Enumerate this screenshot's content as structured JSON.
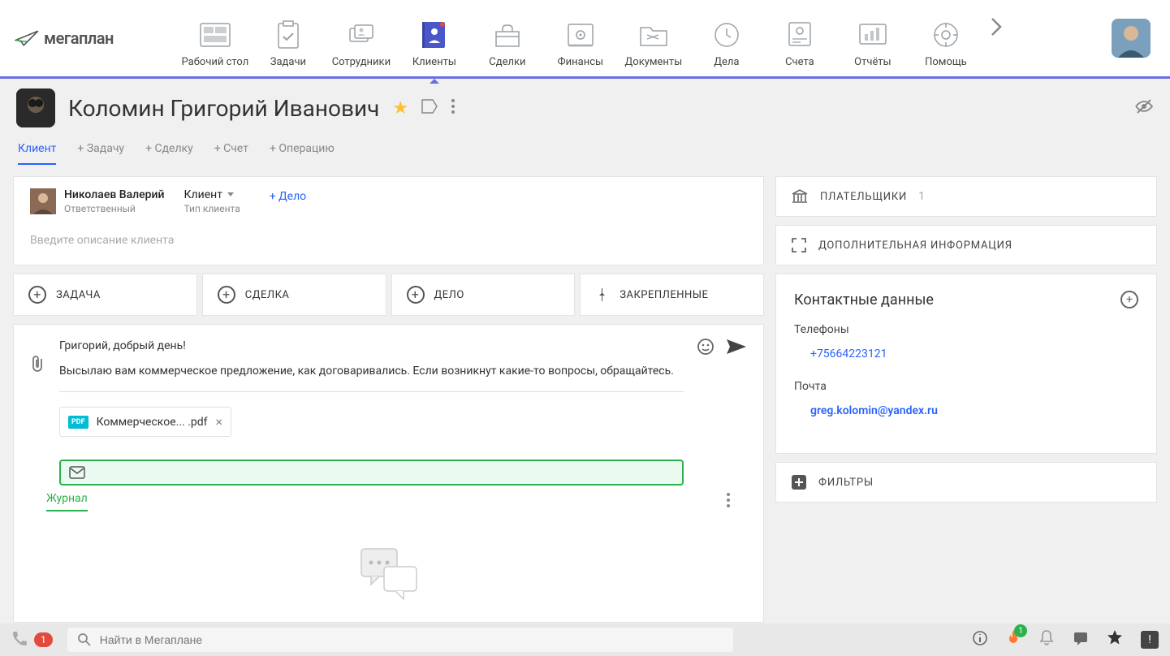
{
  "logo": "мегаплан",
  "nav": [
    {
      "label": "Рабочий стол",
      "active": false
    },
    {
      "label": "Задачи",
      "active": false
    },
    {
      "label": "Сотрудники",
      "active": false
    },
    {
      "label": "Клиенты",
      "active": true
    },
    {
      "label": "Сделки",
      "active": false
    },
    {
      "label": "Финансы",
      "active": false
    },
    {
      "label": "Документы",
      "active": false
    },
    {
      "label": "Дела",
      "active": false
    },
    {
      "label": "Счета",
      "active": false
    },
    {
      "label": "Отчёты",
      "active": false
    },
    {
      "label": "Помощь",
      "active": false
    }
  ],
  "client": {
    "name": "Коломин Григорий Иванович"
  },
  "subtabs": {
    "active": "Клиент",
    "items": [
      "+ Задачу",
      "+ Сделку",
      "+ Счет",
      "+ Операцию"
    ]
  },
  "responsible": {
    "name": "Николаев Валерий",
    "role": "Ответственный",
    "type_value": "Клиент",
    "type_label": "Тип клиента",
    "add_delo": "+ Дело",
    "desc_placeholder": "Введите описание клиента"
  },
  "actions": {
    "task": "ЗАДАЧА",
    "deal": "СДЕЛКА",
    "delo": "ДЕЛО",
    "pinned": "ЗАКРЕПЛЕННЫЕ"
  },
  "compose": {
    "line1": "Григорий, добрый день!",
    "line2": "Высылаю вам коммерческое предложение, как договаривались. Если возникнут какие-то вопросы, обращайтесь.",
    "attachment": "Коммерческое... .pdf",
    "pdf_badge": "PDF"
  },
  "journal": "Журнал",
  "sidebar": {
    "payers": {
      "label": "ПЛАТЕЛЬЩИКИ",
      "count": "1"
    },
    "extra": {
      "label": "ДОПОЛНИТЕЛЬНАЯ ИНФОРМАЦИЯ"
    },
    "contacts_title": "Контактные данные",
    "phones_label": "Телефоны",
    "phone": "+75664223121",
    "mail_label": "Почта",
    "email": "greg.kolomin@yandex.ru",
    "filters": "ФИЛЬТРЫ"
  },
  "bottombar": {
    "badge": "1",
    "search_placeholder": "Найти в Мегаплане",
    "flame_badge": "1"
  }
}
